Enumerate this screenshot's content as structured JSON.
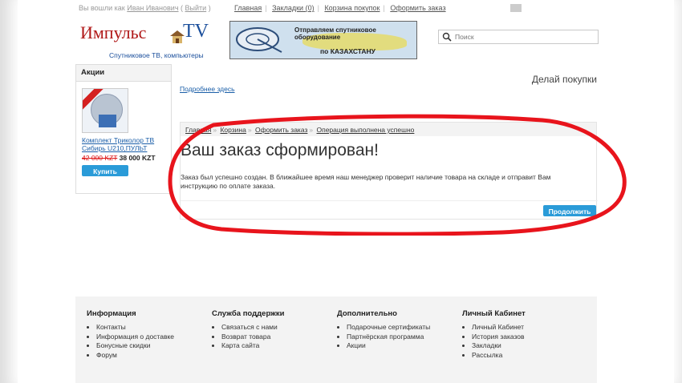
{
  "topbar": {
    "welcome_prefix": "Вы вошли как",
    "user_name": "Иван Иванович",
    "logout": "Выйти",
    "links": [
      "Главная",
      "Закладки (0)",
      "Корзина покупок",
      "Оформить заказ"
    ]
  },
  "header": {
    "logo_name": "Импульс",
    "logo_tv": "TV",
    "logo_sub": "Спутниковое ТВ, компьютеры",
    "banner_line1": "Отправляем спутниковое оборудование",
    "banner_line2": "по КАЗАХСТАНУ",
    "search_placeholder": "Поиск"
  },
  "sidebar": {
    "title": "Акции",
    "product_name": "Комплект Триколор ТВ Сибирь U210,ПУЛЬТ",
    "old_price": "42 000 KZT",
    "new_price": "38 000 KZT",
    "buy_label": "Купить"
  },
  "main": {
    "more_link": "Подробнее здесь",
    "right_heading": "Делай покупки",
    "breadcrumb": [
      "Главная",
      "Корзина",
      "Оформить заказ",
      "Операция выполнена успешно"
    ],
    "title": "Ваш заказ сформирован!",
    "message": "Заказ был успешно создан. В ближайшее время наш менеджер проверит наличие товара на складе и отправит Вам инструкцию по оплате заказа.",
    "continue_label": "Продолжить"
  },
  "footer": {
    "columns": [
      {
        "title": "Информация",
        "items": [
          "Контакты",
          "Информация о доставке",
          "Бонусные скидки",
          "Форум"
        ]
      },
      {
        "title": "Служба поддержки",
        "items": [
          "Связаться с нами",
          "Возврат товара",
          "Карта сайта"
        ]
      },
      {
        "title": "Дополнительно",
        "items": [
          "Подарочные сертификаты",
          "Партнёрская программа",
          "Акции"
        ]
      },
      {
        "title": "Личный Кабинет",
        "items": [
          "Личный Кабинет",
          "История заказов",
          "Закладки",
          "Рассылка"
        ]
      }
    ]
  },
  "colors": {
    "accent": "#2a9bd8",
    "link": "#1a5ea8",
    "highlight": "#e8141c"
  }
}
